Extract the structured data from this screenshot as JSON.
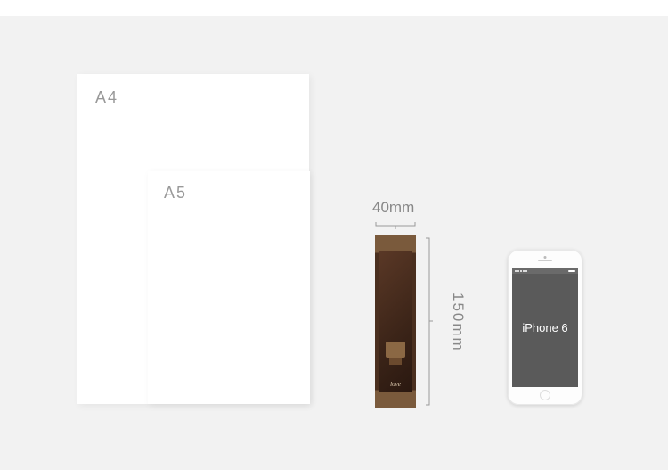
{
  "a4": {
    "label": "A4"
  },
  "a5": {
    "label": "A5"
  },
  "bookmark": {
    "width_label": "40mm",
    "height_label": "150mm",
    "love_text": "love"
  },
  "phone": {
    "label": "iPhone 6"
  }
}
